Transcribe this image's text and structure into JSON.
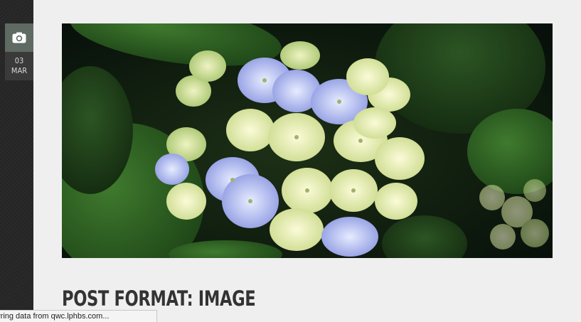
{
  "sidebar": {
    "format_icon": "camera-icon",
    "date_day": "03",
    "date_month": "MAR"
  },
  "post": {
    "title": "POST FORMAT: IMAGE",
    "image_subject": "hydrangea-flower-photo"
  },
  "browser": {
    "status_text": "rring data from qwc.lphbs.com..."
  },
  "colors": {
    "page_background": "#efefef",
    "rail": "#262626",
    "badge": "#5e6a62",
    "title": "#333333"
  }
}
